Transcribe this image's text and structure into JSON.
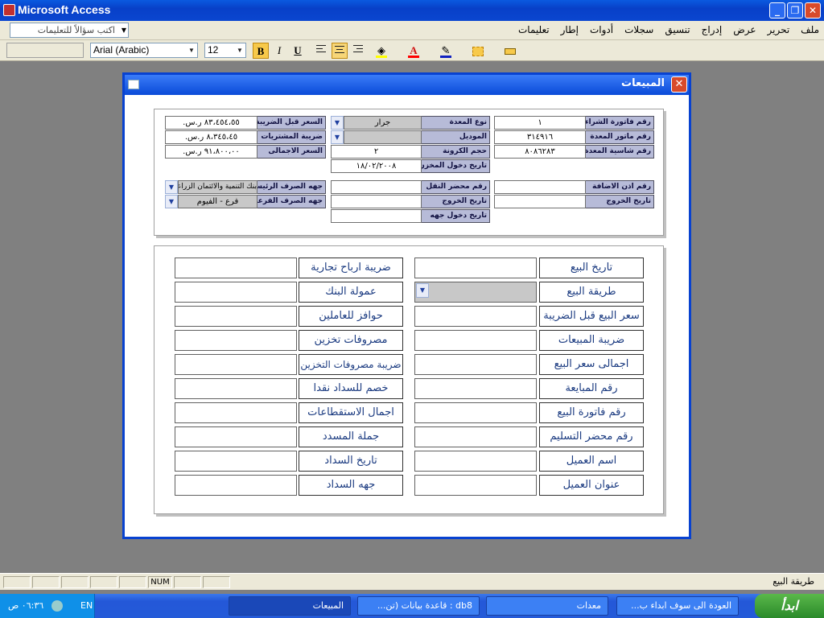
{
  "app": {
    "title": "Microsoft Access",
    "minimize": "_",
    "maximize": "❐",
    "close": "✕"
  },
  "menu": {
    "items": [
      "ملف",
      "تحرير",
      "عرض",
      "إدراج",
      "تنسيق",
      "سجلات",
      "أدوات",
      "إطار",
      "تعليمات"
    ],
    "ask_placeholder": "اكتب سؤالاً للتعليمات"
  },
  "toolbar": {
    "object_value": "",
    "font_name": "Arial (Arabic)",
    "font_size": "12",
    "bold": "B",
    "italic": "I",
    "underline": "U",
    "font_color_glyph": "A",
    "fill_color": "#ffff00",
    "font_color": "#ff0000",
    "line_color": "#1020c0"
  },
  "form": {
    "title": "المبيعات",
    "close": "✕",
    "top": {
      "invoice_no_label": "رقم فاتورة الشراء",
      "invoice_no_value": "١",
      "card_type_label": "نوع المعدة",
      "card_type_value": "جرار",
      "price_before_tax_label": "السعر قبل الضريبة",
      "price_before_tax_value": "٨٣،٤٥٤،٥٥ ر.س.",
      "motor_no_label": "رقم ماتور المعدة",
      "motor_no_value": "٣١٤٩١٦",
      "model_label": "الموديل",
      "model_value": "",
      "purchase_tax_label": "ضريبة المشتريات",
      "purchase_tax_value": "٨،٣٤٥،٤٥ ر.س.",
      "chassis_no_label": "رقم شاسية المعدة",
      "chassis_no_value": "٨٠٨٦٢٨٣",
      "size_label": "حجم الكرونة",
      "size_value": "٢",
      "total_price_label": "السعر الاجمالى",
      "total_price_value": "٩١،٨٠٠،٠٠ ر.س.",
      "entry_date_label": "تاريخ دخول المخزن",
      "entry_date_value": "١٨/٠٢/٢٠٠٨",
      "addition_no_label": "رقم اذن الاضافة",
      "addition_no_value": "",
      "transport_no_label": "رقم محضر النقل",
      "transport_no_value": "",
      "main_bank_label": "جهه الصرف الرئيسية",
      "main_bank_value": "بنك التنمية والائتمان الزراعي",
      "exit_date_label": "تاريخ الخروج",
      "exit_date_value": "",
      "exit_date2_label": "تاريخ الخروج",
      "exit_date2_value": "",
      "sub_bank_label": "جهه الصرف الفرعية",
      "sub_bank_value": "فرع - الفيوم",
      "party_entry_date_label": "تاريخ دخول جهه",
      "party_entry_date_value": ""
    },
    "bottom": {
      "right_labels": [
        "تاريخ البيع",
        "طريقة البيع",
        "سعر البيع قبل الضريبة",
        "ضريبة المبيعات",
        "اجمالى سعر البيع",
        "رقم المبايعة",
        "رقم فاتورة البيع",
        "رقم محضر التسليم",
        "اسم العميل",
        "عنوان العميل"
      ],
      "left_labels": [
        "ضريبة ارباح تجارية",
        "عمولة البنك",
        "حوافز للعاملين",
        "مصروفات تخزين",
        "ضريبة مصروفات التخزين",
        "خصم للسداد نقدا",
        "اجمال الاستقطاعات",
        "جملة المسدد",
        "تاريخ السداد",
        "جهه السداد"
      ]
    }
  },
  "status": {
    "text": "طريقة البيع",
    "num": "NUM"
  },
  "taskbar": {
    "start": "ابدأ",
    "tasks": [
      "العودة الى سوف ابداء ب...",
      "معدات",
      "db8 : قاعدة بيانات (تن...",
      "المبيعات"
    ],
    "lang": "EN",
    "time": "٠٦:٣٦ ص"
  }
}
